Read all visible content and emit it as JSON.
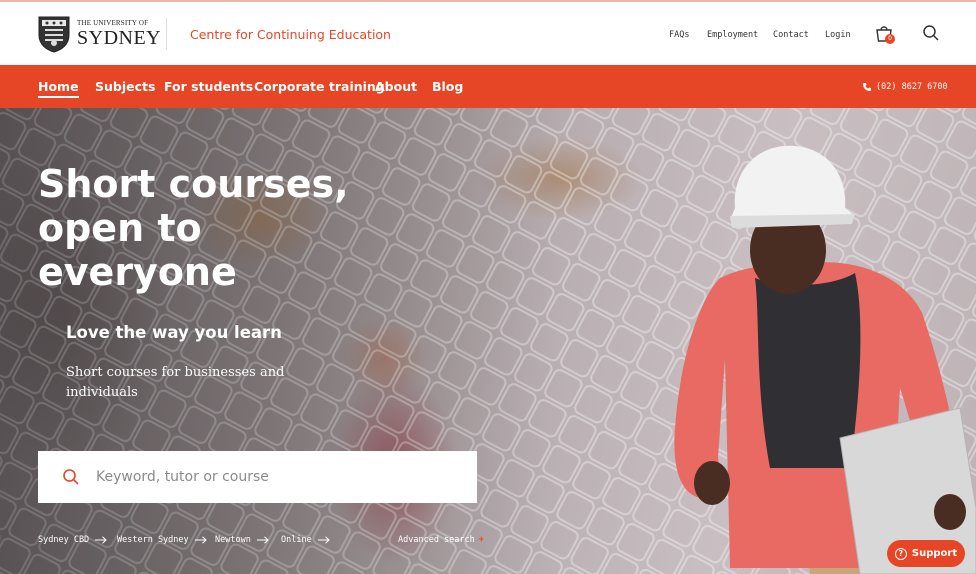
{
  "header": {
    "logo_small": "THE UNIVERSITY OF",
    "logo_big": "SYDNEY",
    "site_name": "Centre for Continuing Education",
    "links": [
      "FAQs",
      "Employment",
      "Contact",
      "Login"
    ],
    "cart_count": "0"
  },
  "nav": {
    "items": [
      "Home",
      "Subjects",
      "For students",
      "Corporate training",
      "About",
      "Blog"
    ],
    "active": "Home",
    "phone": "(02) 8627 6700"
  },
  "hero": {
    "title": "Short courses, open to everyone",
    "subtitle": "Love the way you learn",
    "description": "Short courses for businesses and individuals",
    "search_placeholder": "Keyword, tutor or course",
    "locations": [
      "Sydney CBD",
      "Western Sydney",
      "Newtown",
      "Online"
    ],
    "advanced_search": "Advanced search",
    "advanced_plus": "+"
  },
  "support": {
    "label": "Support",
    "icon_glyph": "?"
  },
  "colors": {
    "accent": "#e64626",
    "text": "#333333"
  }
}
